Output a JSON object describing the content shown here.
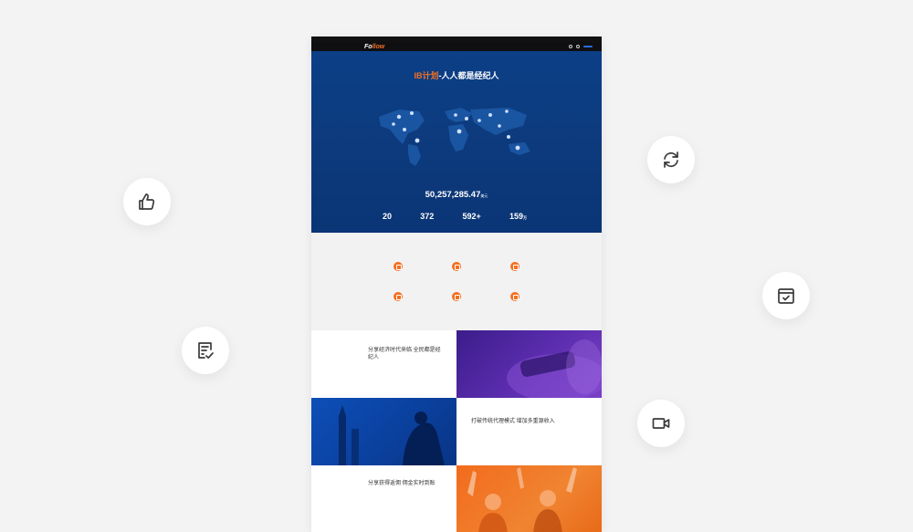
{
  "bubbles": [
    {
      "name": "thumbs-up-icon"
    },
    {
      "name": "checklist-icon"
    },
    {
      "name": "refresh-icon"
    },
    {
      "name": "calendar-check-icon"
    },
    {
      "name": "video-camera-icon"
    }
  ],
  "site": {
    "topbar_left": "",
    "topbar_right": "",
    "logo_main": "Fo",
    "logo_accent": "llow",
    "logo_suffix": "",
    "nav": [
      "",
      "",
      "",
      "",
      "",
      ""
    ],
    "nav_button": ""
  },
  "hero": {
    "title_highlight": "IB计划",
    "title_rest": "-人人都是经纪人",
    "subtitle": "",
    "caption": "",
    "amount": "50,257,285.47",
    "amount_unit": "美元",
    "amount_note": "",
    "stats": [
      {
        "value": "20",
        "suffix": "",
        "label": ""
      },
      {
        "value": "372",
        "suffix": "",
        "label": ""
      },
      {
        "value": "592+",
        "suffix": "",
        "label": ""
      },
      {
        "value": "159",
        "suffix": "万",
        "label": ""
      }
    ]
  },
  "reasons": {
    "title": "",
    "items": [
      "",
      "",
      "",
      "",
      "",
      ""
    ]
  },
  "features": [
    {
      "title": "分享经济时代来临 全民都是经纪人",
      "body": ""
    },
    {
      "title": "打破传统代理模式 增加多重源收入",
      "body": ""
    },
    {
      "title": "分享获得返佣 佣金实时到账",
      "body": ""
    }
  ],
  "colors": {
    "accent": "#f37021",
    "hero_blue": "#0c3f87",
    "nav_dark": "#0f0f12"
  }
}
